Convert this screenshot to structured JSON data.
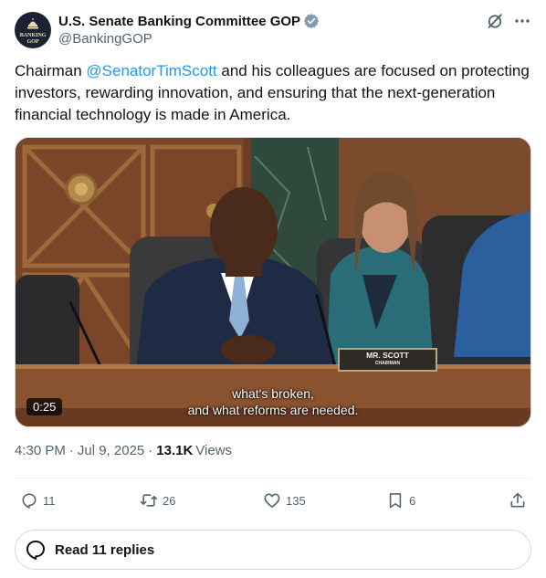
{
  "account": {
    "display_name": "U.S. Senate Banking Committee GOP",
    "handle": "@BankingGOP",
    "avatar_text": "BANKING GOP"
  },
  "tweet": {
    "text_before": "Chairman ",
    "mention": "@SenatorTimScott",
    "text_after": " and his colleagues are focused on protecting investors, rewarding innovation, and ensuring that the next-generation financial technology is made in America."
  },
  "media": {
    "duration": "0:25",
    "caption_line1": "what's broken,",
    "caption_line2": "and what reforms are needed.",
    "placard_name": "MR. SCOTT",
    "placard_title": "CHAIRMAN"
  },
  "meta": {
    "time": "4:30 PM",
    "separator": "·",
    "date": "Jul 9, 2025",
    "views_count": "13.1K",
    "views_label": "Views"
  },
  "actions": {
    "replies": "11",
    "reposts": "26",
    "likes": "135",
    "bookmarks": "6"
  },
  "read_replies": "Read 11 replies",
  "icons": {
    "verified": "verified-badge-icon",
    "grok": "grok-icon",
    "more": "more-icon",
    "reply": "reply-icon",
    "repost": "repost-icon",
    "like": "heart-icon",
    "bookmark": "bookmark-icon",
    "share": "share-icon"
  },
  "colors": {
    "link": "#1d9bf0",
    "secondary_text": "#536471",
    "primary_text": "#0f1419",
    "verified_badge": "#829aab"
  }
}
